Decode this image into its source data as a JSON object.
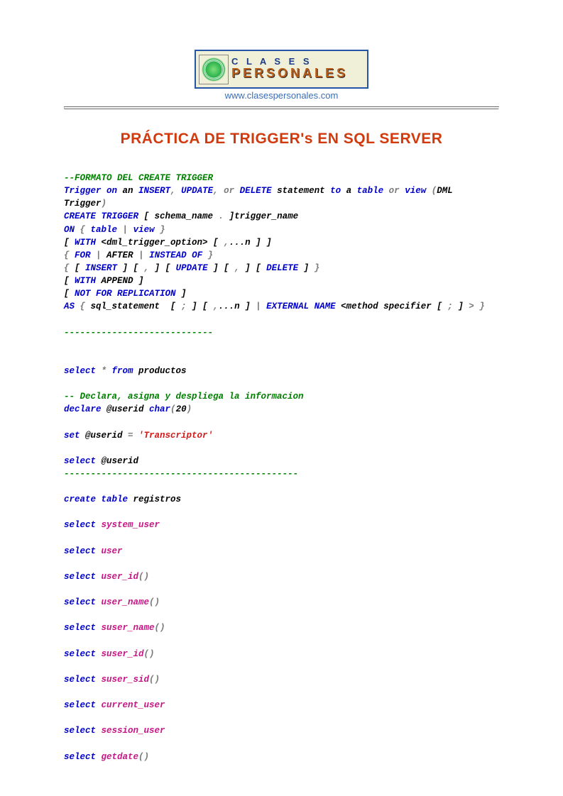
{
  "header": {
    "logo_top": "C L A S E S",
    "logo_bottom": "PERSONALES",
    "url": "www.clasespersonales.com"
  },
  "title": "PRÁCTICA DE TRIGGER's EN SQL SERVER",
  "lines": [
    [
      [
        "gr",
        "--FORMATO DEL CREATE TRIGGER"
      ]
    ],
    [
      [
        "kw",
        "Trigger on"
      ],
      [
        "blk",
        " an "
      ],
      [
        "kw",
        "INSERT"
      ],
      [
        "gy",
        ", "
      ],
      [
        "kw",
        "UPDATE"
      ],
      [
        "gy",
        ", or "
      ],
      [
        "kw",
        "DELETE"
      ],
      [
        "blk",
        " statement "
      ],
      [
        "kw",
        "to"
      ],
      [
        "blk",
        " a "
      ],
      [
        "kw",
        "table"
      ],
      [
        "gy",
        " or "
      ],
      [
        "kw",
        "view"
      ],
      [
        "gy",
        " ("
      ],
      [
        "blk",
        "DML Trigger"
      ],
      [
        "gy",
        ")"
      ]
    ],
    [
      [
        "kw",
        "CREATE TRIGGER"
      ],
      [
        "blk",
        " [ schema_name "
      ],
      [
        "gy",
        "."
      ],
      [
        "blk",
        " ]trigger_name"
      ]
    ],
    [
      [
        "kw",
        "ON"
      ],
      [
        "gy",
        " { "
      ],
      [
        "kw",
        "table"
      ],
      [
        "gy",
        " | "
      ],
      [
        "kw",
        "view"
      ],
      [
        "gy",
        " }"
      ]
    ],
    [
      [
        "blk",
        "[ "
      ],
      [
        "kw",
        "WITH"
      ],
      [
        "blk",
        " <dml_trigger_option> [ "
      ],
      [
        "gy",
        ","
      ],
      [
        "blk",
        "...n ] ]"
      ]
    ],
    [
      [
        "gy",
        "{ "
      ],
      [
        "kw",
        "FOR"
      ],
      [
        "gy",
        " | "
      ],
      [
        "blk",
        "AFTER"
      ],
      [
        "gy",
        " | "
      ],
      [
        "kw",
        "INSTEAD OF"
      ],
      [
        "gy",
        " }"
      ]
    ],
    [
      [
        "gy",
        "{ "
      ],
      [
        "blk",
        "[ "
      ],
      [
        "kw",
        "INSERT"
      ],
      [
        "blk",
        " ] [ "
      ],
      [
        "gy",
        ","
      ],
      [
        "blk",
        " ] [ "
      ],
      [
        "kw",
        "UPDATE"
      ],
      [
        "blk",
        " ] [ "
      ],
      [
        "gy",
        ","
      ],
      [
        "blk",
        " ] [ "
      ],
      [
        "kw",
        "DELETE"
      ],
      [
        "blk",
        " ] "
      ],
      [
        "gy",
        "}"
      ]
    ],
    [
      [
        "blk",
        "[ "
      ],
      [
        "kw",
        "WITH"
      ],
      [
        "blk",
        " APPEND ]"
      ]
    ],
    [
      [
        "blk",
        "[ "
      ],
      [
        "kw",
        "NOT FOR REPLICATION"
      ],
      [
        "blk",
        " ]"
      ]
    ],
    [
      [
        "kw",
        "AS"
      ],
      [
        "gy",
        " { "
      ],
      [
        "blk",
        "sql_statement  [ "
      ],
      [
        "gy",
        ";"
      ],
      [
        "blk",
        " ] [ "
      ],
      [
        "gy",
        ","
      ],
      [
        "blk",
        "...n ] "
      ],
      [
        "gy",
        "| "
      ],
      [
        "kw",
        "EXTERNAL NAME"
      ],
      [
        "blk",
        " <method specifier [ "
      ],
      [
        "gy",
        ";"
      ],
      [
        "blk",
        " ] "
      ],
      [
        "gy",
        "> }"
      ]
    ],
    [
      [
        "blk",
        ""
      ]
    ],
    [
      [
        "gr",
        "----------------------------"
      ]
    ],
    [
      [
        "blk",
        ""
      ]
    ],
    [
      [
        "blk",
        ""
      ]
    ],
    [
      [
        "kw",
        "select"
      ],
      [
        "gy",
        " * "
      ],
      [
        "kw",
        "from"
      ],
      [
        "blk",
        " productos"
      ]
    ],
    [
      [
        "blk",
        ""
      ]
    ],
    [
      [
        "gr",
        "-- Declara, asigna y despliega la informacion"
      ]
    ],
    [
      [
        "kw",
        "declare"
      ],
      [
        "blk",
        " @userid "
      ],
      [
        "kw",
        "char"
      ],
      [
        "gy",
        "("
      ],
      [
        "blk",
        "20"
      ],
      [
        "gy",
        ")"
      ]
    ],
    [
      [
        "blk",
        ""
      ]
    ],
    [
      [
        "kw",
        "set"
      ],
      [
        "blk",
        " @userid "
      ],
      [
        "gy",
        "= "
      ],
      [
        "rd",
        "'Transcriptor'"
      ]
    ],
    [
      [
        "blk",
        ""
      ]
    ],
    [
      [
        "kw",
        "select"
      ],
      [
        "blk",
        " @userid"
      ]
    ],
    [
      [
        "gr",
        "--------------------------------------------"
      ]
    ],
    [
      [
        "blk",
        ""
      ]
    ],
    [
      [
        "kw",
        "create table"
      ],
      [
        "blk",
        " registros"
      ]
    ],
    [
      [
        "blk",
        ""
      ]
    ],
    [
      [
        "kw",
        "select"
      ],
      [
        "blk",
        " "
      ],
      [
        "mg",
        "system_user"
      ]
    ],
    [
      [
        "blk",
        ""
      ]
    ],
    [
      [
        "kw",
        "select"
      ],
      [
        "blk",
        " "
      ],
      [
        "mg",
        "user"
      ]
    ],
    [
      [
        "blk",
        ""
      ]
    ],
    [
      [
        "kw",
        "select"
      ],
      [
        "blk",
        " "
      ],
      [
        "mg",
        "user_id"
      ],
      [
        "gy",
        "()"
      ]
    ],
    [
      [
        "blk",
        ""
      ]
    ],
    [
      [
        "kw",
        "select"
      ],
      [
        "blk",
        " "
      ],
      [
        "mg",
        "user_name"
      ],
      [
        "gy",
        "()"
      ]
    ],
    [
      [
        "blk",
        ""
      ]
    ],
    [
      [
        "kw",
        "select"
      ],
      [
        "blk",
        " "
      ],
      [
        "mg",
        "suser_name"
      ],
      [
        "gy",
        "()"
      ]
    ],
    [
      [
        "blk",
        ""
      ]
    ],
    [
      [
        "kw",
        "select"
      ],
      [
        "blk",
        " "
      ],
      [
        "mg",
        "suser_id"
      ],
      [
        "gy",
        "()"
      ]
    ],
    [
      [
        "blk",
        ""
      ]
    ],
    [
      [
        "kw",
        "select"
      ],
      [
        "blk",
        " "
      ],
      [
        "mg",
        "suser_sid"
      ],
      [
        "gy",
        "()"
      ]
    ],
    [
      [
        "blk",
        ""
      ]
    ],
    [
      [
        "kw",
        "select"
      ],
      [
        "blk",
        " "
      ],
      [
        "mg",
        "current_user"
      ]
    ],
    [
      [
        "blk",
        ""
      ]
    ],
    [
      [
        "kw",
        "select"
      ],
      [
        "blk",
        " "
      ],
      [
        "mg",
        "session_user"
      ]
    ],
    [
      [
        "blk",
        ""
      ]
    ],
    [
      [
        "kw",
        "select"
      ],
      [
        "blk",
        " "
      ],
      [
        "mg",
        "getdate"
      ],
      [
        "gy",
        "()"
      ]
    ]
  ]
}
